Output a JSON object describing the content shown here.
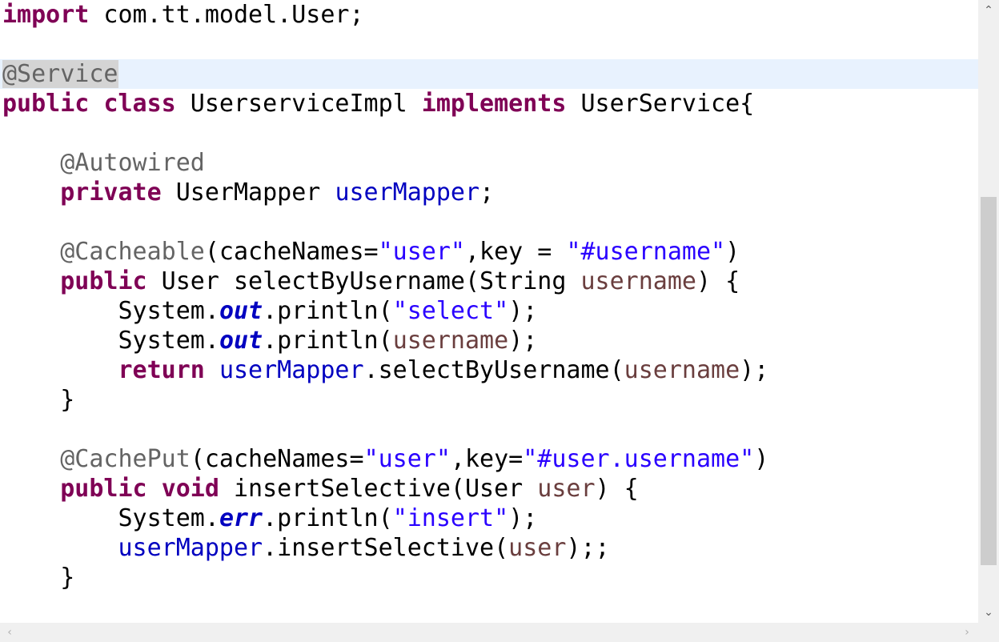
{
  "code_lines": [
    [
      {
        "t": "keyword",
        "v": "import"
      },
      {
        "t": "plain",
        "v": " com.tt.model.User;"
      }
    ],
    [],
    [
      {
        "t": "ann-sel",
        "v": "@Service"
      }
    ],
    [
      {
        "t": "keyword",
        "v": "public"
      },
      {
        "t": "plain",
        "v": " "
      },
      {
        "t": "keyword",
        "v": "class"
      },
      {
        "t": "plain",
        "v": " UserserviceImpl "
      },
      {
        "t": "keyword",
        "v": "implements"
      },
      {
        "t": "plain",
        "v": " UserService{"
      }
    ],
    [],
    [
      {
        "t": "plain",
        "v": "    "
      },
      {
        "t": "annotation",
        "v": "@Autowired"
      }
    ],
    [
      {
        "t": "plain",
        "v": "    "
      },
      {
        "t": "keyword",
        "v": "private"
      },
      {
        "t": "plain",
        "v": " UserMapper "
      },
      {
        "t": "field",
        "v": "userMapper"
      },
      {
        "t": "plain",
        "v": ";"
      }
    ],
    [],
    [
      {
        "t": "plain",
        "v": "    "
      },
      {
        "t": "annotation",
        "v": "@Cacheable"
      },
      {
        "t": "plain",
        "v": "(cacheNames="
      },
      {
        "t": "string",
        "v": "\"user\""
      },
      {
        "t": "plain",
        "v": ",key = "
      },
      {
        "t": "string",
        "v": "\"#username\""
      },
      {
        "t": "plain",
        "v": ")"
      }
    ],
    [
      {
        "t": "plain",
        "v": "    "
      },
      {
        "t": "keyword",
        "v": "public"
      },
      {
        "t": "plain",
        "v": " User selectByUsername(String "
      },
      {
        "t": "param",
        "v": "username"
      },
      {
        "t": "plain",
        "v": ") {"
      }
    ],
    [
      {
        "t": "plain",
        "v": "        System."
      },
      {
        "t": "static",
        "v": "out"
      },
      {
        "t": "plain",
        "v": ".println("
      },
      {
        "t": "string",
        "v": "\"select\""
      },
      {
        "t": "plain",
        "v": ");"
      }
    ],
    [
      {
        "t": "plain",
        "v": "        System."
      },
      {
        "t": "static",
        "v": "out"
      },
      {
        "t": "plain",
        "v": ".println("
      },
      {
        "t": "param",
        "v": "username"
      },
      {
        "t": "plain",
        "v": ");"
      }
    ],
    [
      {
        "t": "plain",
        "v": "        "
      },
      {
        "t": "keyword",
        "v": "return"
      },
      {
        "t": "plain",
        "v": " "
      },
      {
        "t": "field",
        "v": "userMapper"
      },
      {
        "t": "plain",
        "v": ".selectByUsername("
      },
      {
        "t": "param",
        "v": "username"
      },
      {
        "t": "plain",
        "v": ");"
      }
    ],
    [
      {
        "t": "plain",
        "v": "    }"
      }
    ],
    [],
    [
      {
        "t": "plain",
        "v": "    "
      },
      {
        "t": "annotation",
        "v": "@CachePut"
      },
      {
        "t": "plain",
        "v": "(cacheNames="
      },
      {
        "t": "string",
        "v": "\"user\""
      },
      {
        "t": "plain",
        "v": ",key="
      },
      {
        "t": "string",
        "v": "\"#user.username\""
      },
      {
        "t": "plain",
        "v": ")"
      }
    ],
    [
      {
        "t": "plain",
        "v": "    "
      },
      {
        "t": "keyword",
        "v": "public"
      },
      {
        "t": "plain",
        "v": " "
      },
      {
        "t": "keyword",
        "v": "void"
      },
      {
        "t": "plain",
        "v": " insertSelective(User "
      },
      {
        "t": "param",
        "v": "user"
      },
      {
        "t": "plain",
        "v": ") {"
      }
    ],
    [
      {
        "t": "plain",
        "v": "        System."
      },
      {
        "t": "static",
        "v": "err"
      },
      {
        "t": "plain",
        "v": ".println("
      },
      {
        "t": "string",
        "v": "\"insert\""
      },
      {
        "t": "plain",
        "v": ");"
      }
    ],
    [
      {
        "t": "plain",
        "v": "        "
      },
      {
        "t": "field",
        "v": "userMapper"
      },
      {
        "t": "plain",
        "v": ".insertSelective("
      },
      {
        "t": "param",
        "v": "user"
      },
      {
        "t": "plain",
        "v": ");;"
      }
    ],
    [
      {
        "t": "plain",
        "v": "    }"
      }
    ]
  ],
  "highlighted_line": 2,
  "scrollbar": {
    "up_arrow": "⌃",
    "down_arrow": "⌄",
    "left_arrow": "‹",
    "right_arrow": "›"
  },
  "colors": {
    "keyword": "#7f0055",
    "annotation": "#646464",
    "string": "#2a00ff",
    "field": "#0000c0",
    "param": "#6a3e3e",
    "current_line": "#e8f2fe"
  }
}
